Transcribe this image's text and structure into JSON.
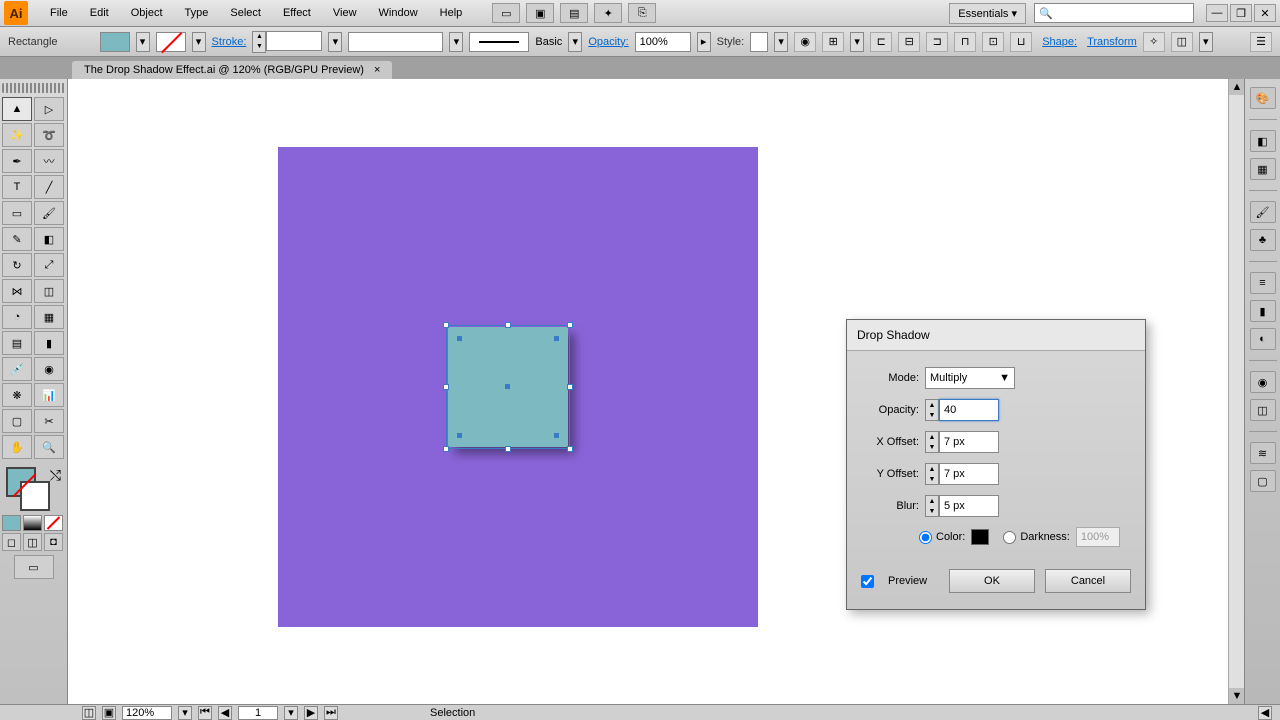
{
  "app": {
    "initials": "Ai"
  },
  "menu": [
    "File",
    "Edit",
    "Object",
    "Type",
    "Select",
    "Effect",
    "View",
    "Window",
    "Help"
  ],
  "workspace": "Essentials",
  "controlbar": {
    "shape_name": "Rectangle",
    "stroke_label": "Stroke:",
    "brush_label": "Basic",
    "opacity_label": "Opacity:",
    "opacity_value": "100%",
    "style_label": "Style:",
    "shape_link": "Shape:",
    "transform_link": "Transform"
  },
  "document": {
    "tab_title": "The Drop Shadow Effect.ai @ 120% (RGB/GPU Preview)"
  },
  "dialog": {
    "title": "Drop Shadow",
    "mode_label": "Mode:",
    "mode_value": "Multiply",
    "opacity_label": "Opacity:",
    "opacity_value": "40",
    "xoffset_label": "X Offset:",
    "xoffset_value": "7 px",
    "yoffset_label": "Y Offset:",
    "yoffset_value": "7 px",
    "blur_label": "Blur:",
    "blur_value": "5 px",
    "color_label": "Color:",
    "darkness_label": "Darkness:",
    "darkness_value": "100%",
    "preview_label": "Preview",
    "ok": "OK",
    "cancel": "Cancel"
  },
  "status": {
    "zoom": "120%",
    "page": "1",
    "tool": "Selection"
  },
  "colors": {
    "artboard": "#8964d8",
    "shape": "#7cb9c0"
  }
}
